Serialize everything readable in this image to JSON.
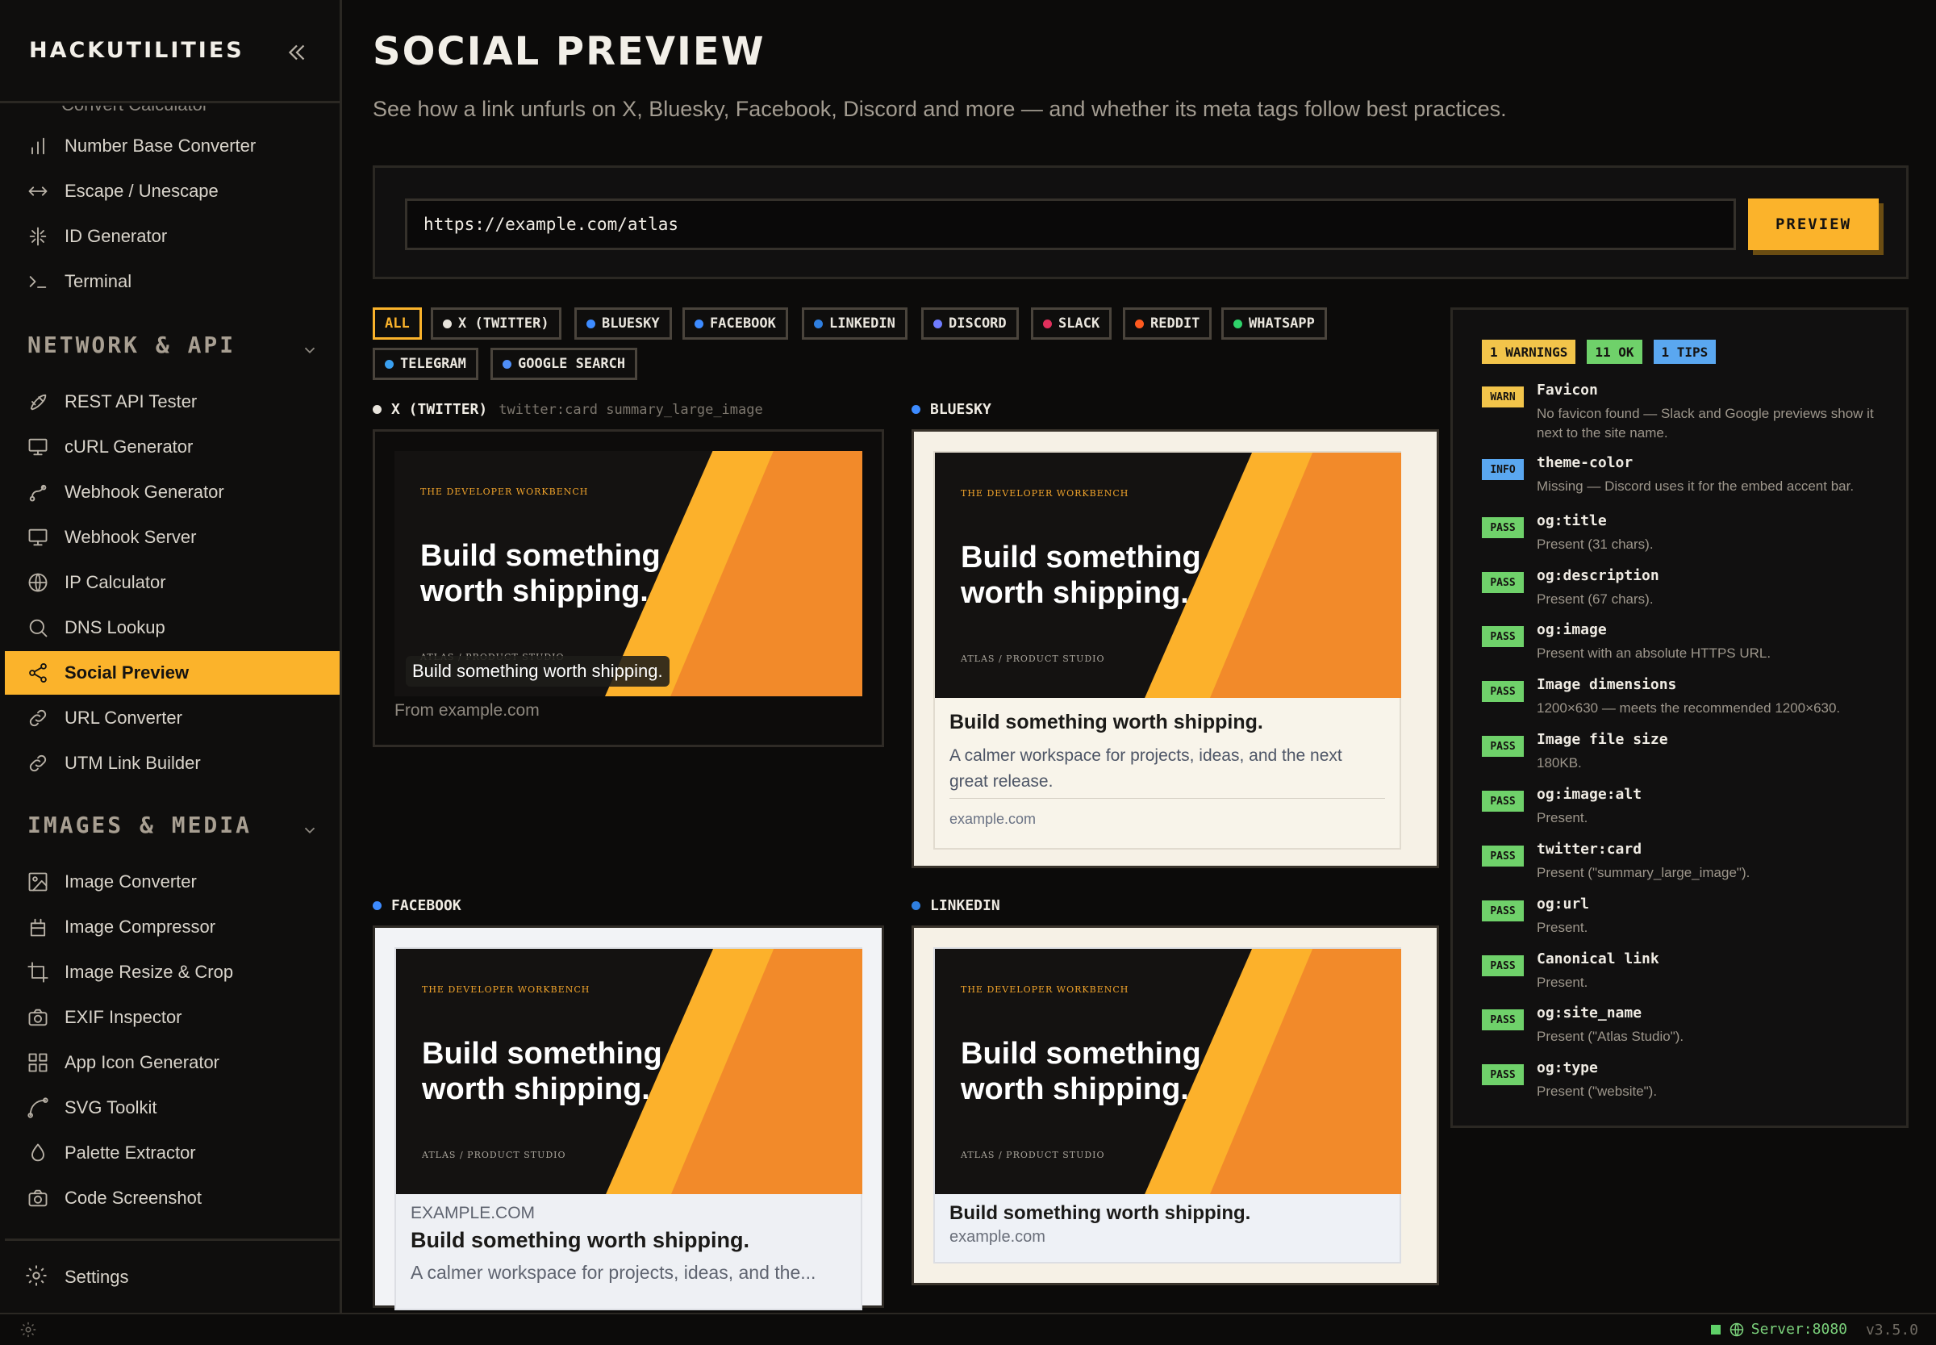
{
  "sidebar": {
    "brand": "HACKUTILITIES",
    "partial_item": "Convert Calculator",
    "items_top": [
      {
        "label": "Number Base Converter",
        "icon": "bar-chart-icon"
      },
      {
        "label": "Escape / Unescape",
        "icon": "arrows-horizontal-icon"
      },
      {
        "label": "ID Generator",
        "icon": "fingerprint-icon"
      },
      {
        "label": "Terminal",
        "icon": "terminal-icon"
      }
    ],
    "section_network": "NETWORK & API",
    "items_network": [
      {
        "label": "REST API Tester",
        "icon": "rocket-icon"
      },
      {
        "label": "cURL Generator",
        "icon": "monitor-icon"
      },
      {
        "label": "Webhook Generator",
        "icon": "webhook-icon"
      },
      {
        "label": "Webhook Server",
        "icon": "monitor-icon"
      },
      {
        "label": "IP Calculator",
        "icon": "globe-icon"
      },
      {
        "label": "DNS Lookup",
        "icon": "search-icon"
      },
      {
        "label": "Social Preview",
        "icon": "share-icon"
      },
      {
        "label": "URL Converter",
        "icon": "link-icon"
      },
      {
        "label": "UTM Link Builder",
        "icon": "link-icon"
      }
    ],
    "section_images": "IMAGES & MEDIA",
    "items_images": [
      {
        "label": "Image Converter",
        "icon": "image-icon"
      },
      {
        "label": "Image Compressor",
        "icon": "compress-icon"
      },
      {
        "label": "Image Resize & Crop",
        "icon": "crop-icon"
      },
      {
        "label": "EXIF Inspector",
        "icon": "camera-icon"
      },
      {
        "label": "App Icon Generator",
        "icon": "grid-icon"
      },
      {
        "label": "SVG Toolkit",
        "icon": "bezier-icon"
      },
      {
        "label": "Palette Extractor",
        "icon": "droplet-icon"
      },
      {
        "label": "Code Screenshot",
        "icon": "camera-icon"
      }
    ],
    "settings": "Settings"
  },
  "main": {
    "title": "SOCIAL PREVIEW",
    "subtitle": "See how a link unfurls on X, Bluesky, Facebook, Discord and more — and whether its meta tags follow best practices.",
    "url_value": "https://example.com/atlas",
    "preview_button": "PREVIEW",
    "filters": [
      {
        "label": "ALL",
        "color": ""
      },
      {
        "label": "X (TWITTER)",
        "color": "#e8e4dc"
      },
      {
        "label": "BLUESKY",
        "color": "#3d8bff"
      },
      {
        "label": "FACEBOOK",
        "color": "#3d8bff"
      },
      {
        "label": "LINKEDIN",
        "color": "#2f7fe0"
      },
      {
        "label": "DISCORD",
        "color": "#6f7cff"
      },
      {
        "label": "SLACK",
        "color": "#e0305c"
      },
      {
        "label": "REDDIT",
        "color": "#ff5a1f"
      },
      {
        "label": "WHATSAPP",
        "color": "#2fd36a"
      },
      {
        "label": "TELEGRAM",
        "color": "#3aa0f0"
      },
      {
        "label": "GOOGLE SEARCH",
        "color": "#4f8ef7"
      }
    ]
  },
  "og_image": {
    "kicker": "THE DEVELOPER WORKBENCH",
    "headline": "Build something worth shipping.",
    "footer": "ATLAS / PRODUCT STUDIO"
  },
  "cards": {
    "x": {
      "name": "X (TWITTER)",
      "meta": "twitter:card summary_large_image",
      "overlay": "Build something worth shipping.",
      "from": "From example.com",
      "dot": "#e8e4dc"
    },
    "bluesky": {
      "name": "BLUESKY",
      "title": "Build something worth shipping.",
      "desc": "A calmer workspace for projects, ideas, and the next great release.",
      "domain": "example.com",
      "dot": "#3d8bff"
    },
    "facebook": {
      "name": "FACEBOOK",
      "domain": "EXAMPLE.COM",
      "title": "Build something worth shipping.",
      "desc": "A calmer workspace for projects, ideas, and the...",
      "dot": "#3d8bff"
    },
    "linkedin": {
      "name": "LINKEDIN",
      "title": "Build something worth shipping.",
      "domain": "example.com",
      "dot": "#2f7fe0"
    }
  },
  "checks": {
    "summary": [
      {
        "label": "1 WARNINGS",
        "color": "#f2c44a"
      },
      {
        "label": "11 OK",
        "color": "#6fd16a"
      },
      {
        "label": "1 TIPS",
        "color": "#5aa7f0"
      }
    ],
    "items": [
      {
        "badge": "WARN",
        "color": "#f2c44a",
        "name": "Favicon",
        "desc": "No favicon found — Slack and Google previews show it next to the site name."
      },
      {
        "badge": "INFO",
        "color": "#5aa7f0",
        "name": "theme-color",
        "desc": "Missing — Discord uses it for the embed accent bar."
      },
      {
        "badge": "PASS",
        "color": "#6fd16a",
        "name": "og:title",
        "desc": "Present (31 chars)."
      },
      {
        "badge": "PASS",
        "color": "#6fd16a",
        "name": "og:description",
        "desc": "Present (67 chars)."
      },
      {
        "badge": "PASS",
        "color": "#6fd16a",
        "name": "og:image",
        "desc": "Present with an absolute HTTPS URL."
      },
      {
        "badge": "PASS",
        "color": "#6fd16a",
        "name": "Image dimensions",
        "desc": "1200×630 — meets the recommended 1200×630."
      },
      {
        "badge": "PASS",
        "color": "#6fd16a",
        "name": "Image file size",
        "desc": "180KB."
      },
      {
        "badge": "PASS",
        "color": "#6fd16a",
        "name": "og:image:alt",
        "desc": "Present."
      },
      {
        "badge": "PASS",
        "color": "#6fd16a",
        "name": "twitter:card",
        "desc": "Present (\"summary_large_image\")."
      },
      {
        "badge": "PASS",
        "color": "#6fd16a",
        "name": "og:url",
        "desc": "Present."
      },
      {
        "badge": "PASS",
        "color": "#6fd16a",
        "name": "Canonical link",
        "desc": "Present."
      },
      {
        "badge": "PASS",
        "color": "#6fd16a",
        "name": "og:site_name",
        "desc": "Present (\"Atlas Studio\")."
      },
      {
        "badge": "PASS",
        "color": "#6fd16a",
        "name": "og:type",
        "desc": "Present (\"website\")."
      }
    ]
  },
  "statusbar": {
    "server": "Server:8080",
    "version": "v3.5.0"
  },
  "colors": {
    "accent": "#fbb32b",
    "og_orange": "#f28a2a",
    "og_yellow": "#fcb12b"
  }
}
